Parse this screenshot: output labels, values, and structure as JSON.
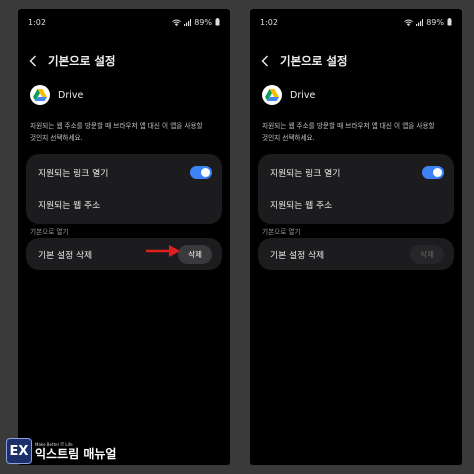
{
  "screens": [
    {
      "status": {
        "time": "1:02",
        "battery": "89%"
      },
      "title": "기본으로 설정",
      "app_name": "Drive",
      "description": "지원되는 웹 주소를 방문할 때 브라우저 앱 대신 이 앱을 사용할\n것인지 선택하세요.",
      "links_label": "지원되는 링크 열기",
      "links_toggle_on": true,
      "web_address_label": "지원되는 웹 주소",
      "section_label": "기본으로 열기",
      "clear_defaults_label": "기본 설정 삭제",
      "clear_button": "삭제",
      "clear_button_enabled": true
    },
    {
      "status": {
        "time": "1:02",
        "battery": "89%"
      },
      "title": "기본으로 설정",
      "app_name": "Drive",
      "description": "지원되는 웹 주소를 방문할 때 브라우저 앱 대신 이 앱을 사용할\n것인지 선택하세요.",
      "links_label": "지원되는 링크 열기",
      "links_toggle_on": true,
      "web_address_label": "지원되는 웹 주소",
      "section_label": "기본으로 열기",
      "clear_defaults_label": "기본 설정 삭제",
      "clear_button": "삭제",
      "clear_button_enabled": false
    }
  ],
  "colors": {
    "accent_toggle": "#3e82f7",
    "annotation_arrow": "#e02020",
    "background": "#3a3a3a",
    "card": "#1c1c1e"
  },
  "icons": [
    "back-icon",
    "wifi-icon",
    "signal-icon",
    "drive-icon",
    "arrow-annotation"
  ],
  "watermark": {
    "badge": "EX",
    "tagline": "Make Better IT Life",
    "name": "익스트림 매뉴얼"
  }
}
